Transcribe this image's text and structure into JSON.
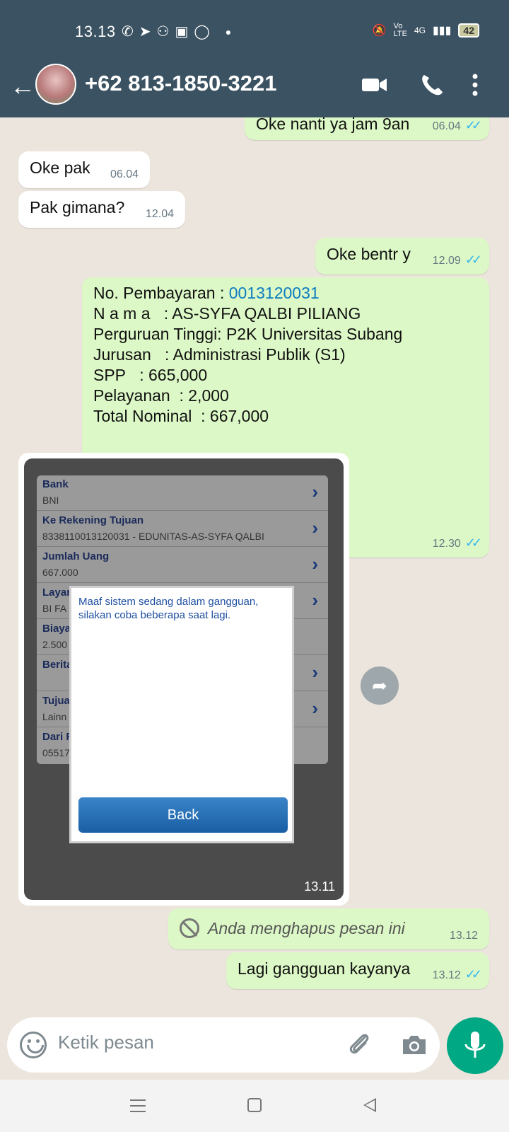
{
  "status_bar": {
    "time": "13.13",
    "left_icons": [
      "whatsapp-icon",
      "telegram-icon",
      "person-add-icon",
      "app-icon",
      "circle-icon",
      "dot-icon"
    ],
    "network": "4G",
    "battery": "42"
  },
  "header": {
    "contact_name": "+62 813-1850-3221",
    "icons": [
      "back-arrow-icon",
      "video-call-icon",
      "phone-icon",
      "more-vert-icon"
    ]
  },
  "messages": [
    {
      "dir": "out",
      "text": "Oke nanti ya jam 9an",
      "time": "06.04",
      "read": true
    },
    {
      "dir": "in",
      "text": "Oke pak",
      "time": "06.04"
    },
    {
      "dir": "in",
      "text": "Pak gimana?",
      "time": "12.04"
    },
    {
      "dir": "out",
      "text": "Oke bentr y",
      "time": "12.09",
      "read": true
    }
  ],
  "payment_message": {
    "lines": [
      {
        "label": "No. Pembayaran :",
        "value": "0013120031"
      },
      {
        "label": "N a m a",
        "sep": ":",
        "value": "AS-SYFA QALBI PILIANG"
      },
      {
        "label": "Perguruan Tinggi:",
        "value": "P2K Universitas Subang"
      },
      {
        "label": "Jurusan",
        "sep": ":",
        "value": "Administrasi Publik (S1)"
      },
      {
        "label": "SPP",
        "sep": ":",
        "value": "665,000"
      },
      {
        "label": "Pelayanan",
        "sep": ":",
        "value": "2,000"
      },
      {
        "label": "Total Nominal",
        "sep": ":",
        "value": "667,000"
      }
    ],
    "time": "12.30",
    "read": true
  },
  "image_message": {
    "form_rows": [
      {
        "label": "Bank",
        "value": "BNI"
      },
      {
        "label": "Ke Rekening Tujuan",
        "value": "8338110013120031 - EDUNITAS-AS-SYFA QALBI"
      },
      {
        "label": "Jumlah Uang",
        "value": "667.000"
      },
      {
        "label": "Layar",
        "value": "BI FA"
      },
      {
        "label": "Biaya",
        "value": "2.500"
      },
      {
        "label": "Berita",
        "value": ""
      },
      {
        "label": "Tujua",
        "value": "Lainn"
      },
      {
        "label": "Dari R",
        "value": "05517"
      }
    ],
    "dialog_message": "Maaf sistem sedang dalam gangguan, silakan coba beberapa saat lagi.",
    "dialog_button": "Back",
    "time": "13.11"
  },
  "deleted_message": {
    "text": "Anda menghapus pesan ini",
    "time": "13.12"
  },
  "last_message": {
    "text": "Lagi gangguan kayanya",
    "time": "13.12",
    "read": true
  },
  "input": {
    "placeholder": "Ketik pesan"
  }
}
